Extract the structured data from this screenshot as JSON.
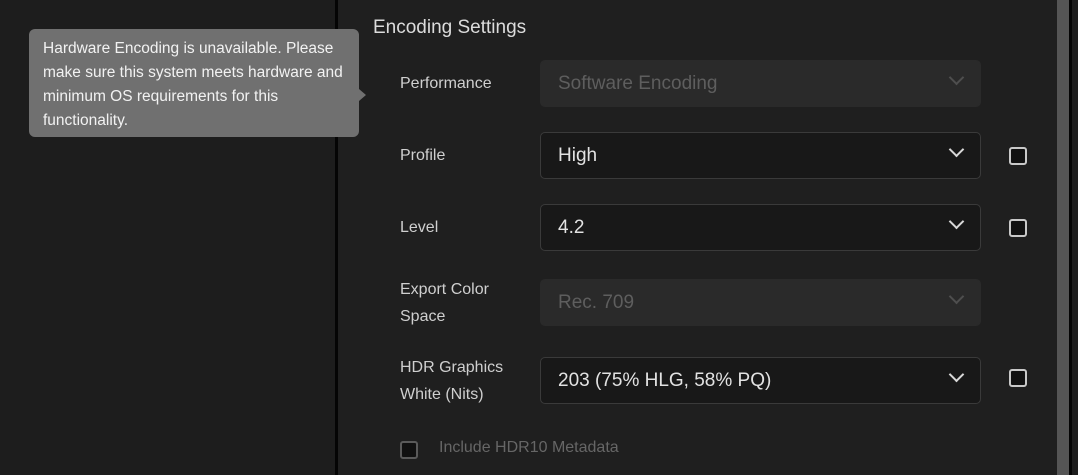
{
  "tooltip": {
    "text": "Hardware Encoding is unavailable. Please make sure this system meets hardware and minimum OS requirements for this functionality."
  },
  "section": {
    "title": "Encoding Settings"
  },
  "fields": {
    "performance": {
      "label": "Performance",
      "value": "Software Encoding",
      "disabled": true
    },
    "profile": {
      "label": "Profile",
      "value": "High"
    },
    "level": {
      "label": "Level",
      "value": "4.2"
    },
    "color_space": {
      "label_line1": "Export Color",
      "label_line2": "Space",
      "value": "Rec. 709",
      "disabled": true
    },
    "hdr_white": {
      "label_line1": "HDR Graphics",
      "label_line2": "White (Nits)",
      "value": "203 (75% HLG, 58% PQ)"
    }
  },
  "hdr10": {
    "label": "Include HDR10 Metadata",
    "checked": false,
    "disabled": true
  }
}
